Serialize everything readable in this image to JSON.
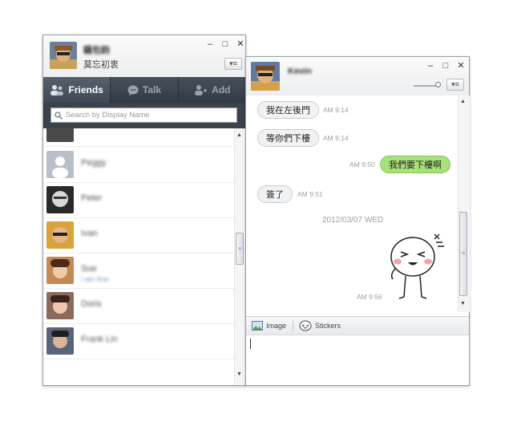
{
  "friends_window": {
    "profile": {
      "name": "騷包鈞",
      "status": "莫忘初衷"
    },
    "controls": {
      "minimize": "–",
      "maximize": "□",
      "close": "✕",
      "menu": "▾≡"
    },
    "tabs": [
      {
        "label": "Friends",
        "icon": "friends-icon"
      },
      {
        "label": "Talk",
        "icon": "talk-icon"
      },
      {
        "label": "Add",
        "icon": "add-friend-icon"
      }
    ],
    "search": {
      "placeholder": "Search by Display Name"
    },
    "friends": [
      {
        "name": "Peggy",
        "status": ""
      },
      {
        "name": "Peter",
        "status": ""
      },
      {
        "name": "Ivan",
        "status": ""
      },
      {
        "name": "Sue",
        "status": "I am fine"
      },
      {
        "name": "Doris",
        "status": ""
      },
      {
        "name": "Frank Lin",
        "status": ""
      }
    ]
  },
  "chat_window": {
    "contact_name": "Kevin",
    "controls": {
      "minimize": "–",
      "maximize": "□",
      "close": "✕",
      "menu": "▾≡"
    },
    "messages": [
      {
        "text": "我在左後門",
        "time": "AM 9:14",
        "dir": "in"
      },
      {
        "text": "等你們下樓",
        "time": "AM 9:14",
        "dir": "in"
      },
      {
        "text": "我們要下樓啊",
        "time": "AM 9:50",
        "dir": "out"
      },
      {
        "text": "簽了",
        "time": "AM 9:51",
        "dir": "in"
      }
    ],
    "date_separator": "2012/03/07 WED",
    "sticker_time": "AM 9:56",
    "toolbar": {
      "image_label": "Image",
      "stickers_label": "Stickers"
    }
  }
}
